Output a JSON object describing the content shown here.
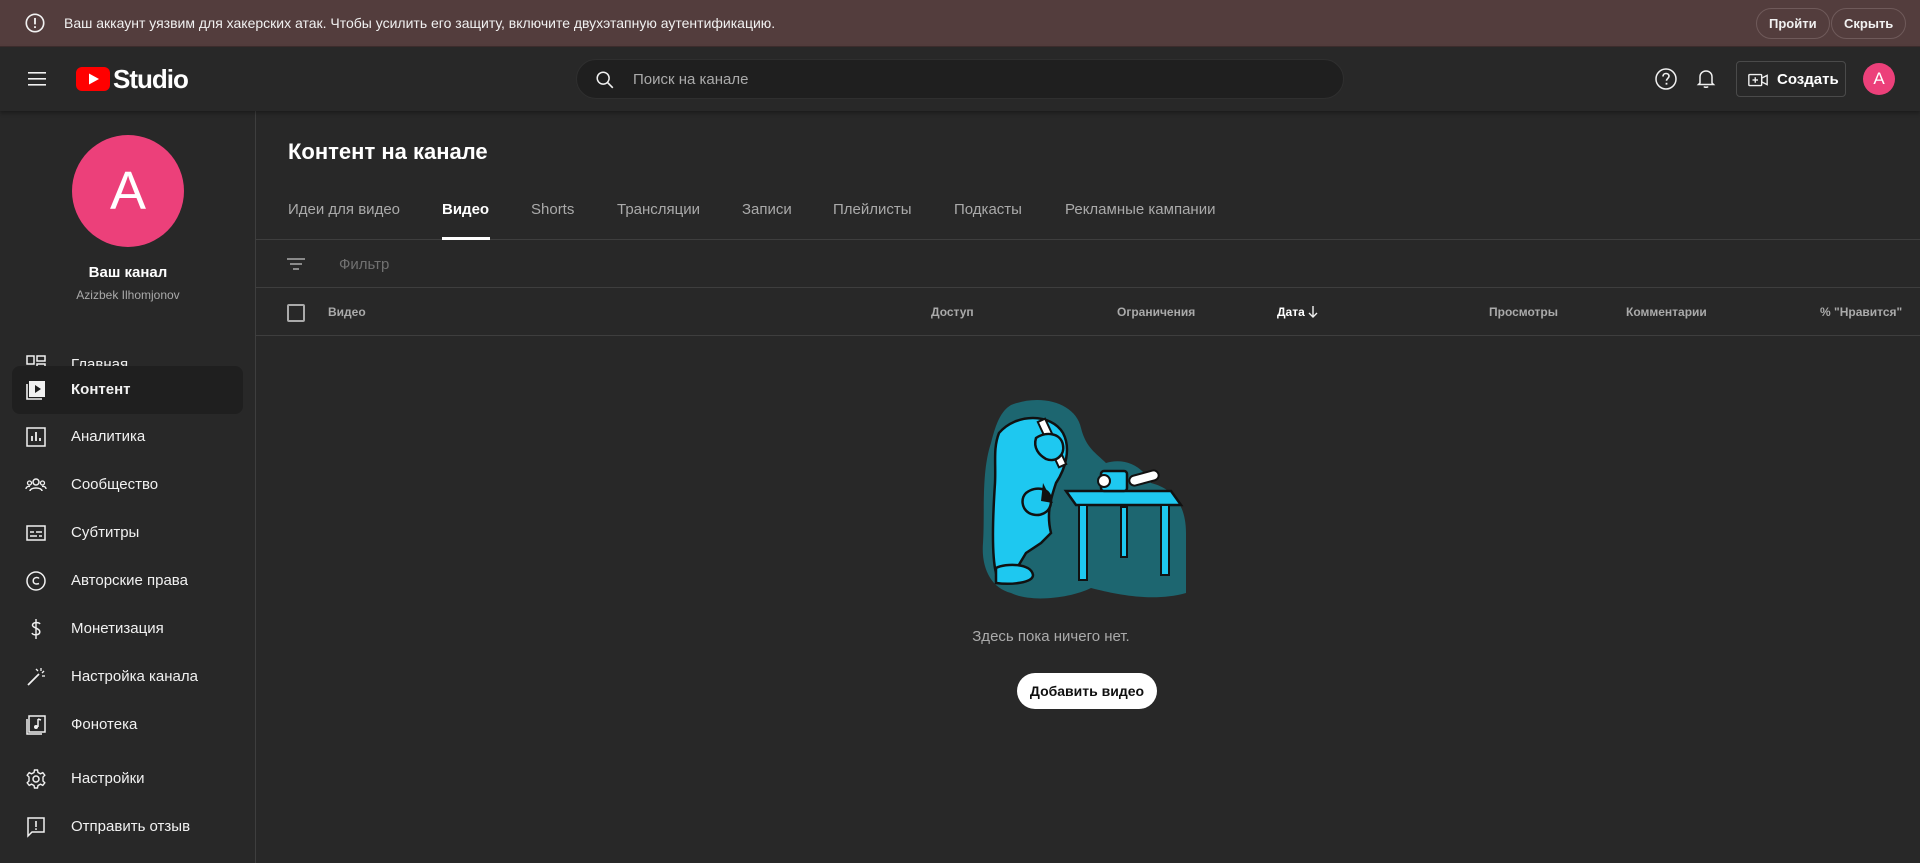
{
  "banner": {
    "text": "Ваш аккаунт уязвим для хакерских атак. Чтобы усилить его защиту, включите двухэтапную аутентификацию.",
    "go_label": "Пройти",
    "hide_label": "Скрыть",
    "icon": "warning-circle-icon",
    "background": "#533d3d"
  },
  "topbar": {
    "logo_text": "Studio",
    "search_placeholder": "Поиск на канале",
    "create_label": "Создать",
    "avatar_letter": "A",
    "avatar_color": "#ec407a"
  },
  "sidebar": {
    "avatar_letter": "A",
    "channel_name": "Ваш канал",
    "channel_handle": "Azizbek Ilhomjonov",
    "items": [
      {
        "label": "Главная",
        "icon": "dashboard-icon"
      },
      {
        "label": "Контент",
        "icon": "content-icon",
        "active": true
      },
      {
        "label": "Аналитика",
        "icon": "analytics-icon"
      },
      {
        "label": "Сообщество",
        "icon": "community-icon"
      },
      {
        "label": "Субтитры",
        "icon": "subtitles-icon"
      },
      {
        "label": "Авторские права",
        "icon": "copyright-icon"
      },
      {
        "label": "Монетизация",
        "icon": "monetization-icon"
      },
      {
        "label": "Настройка канала",
        "icon": "customization-icon"
      },
      {
        "label": "Фонотека",
        "icon": "audio-library-icon"
      },
      {
        "label": "Настройки",
        "icon": "settings-icon"
      },
      {
        "label": "Отправить отзыв",
        "icon": "feedback-icon"
      }
    ]
  },
  "main": {
    "title": "Контент на канале",
    "tabs": [
      {
        "label": "Идеи для видео"
      },
      {
        "label": "Видео",
        "active": true
      },
      {
        "label": "Shorts"
      },
      {
        "label": "Трансляции"
      },
      {
        "label": "Записи"
      },
      {
        "label": "Плейлисты"
      },
      {
        "label": "Подкасты"
      },
      {
        "label": "Рекламные кампании"
      }
    ],
    "filter_placeholder": "Фильтр",
    "columns": [
      "Видео",
      "Доступ",
      "Ограничения",
      "Дата",
      "Просмотры",
      "Комментарии",
      "% \"Нравится\""
    ],
    "sorted_column": "Дата",
    "empty_text": "Здесь пока ничего нет.",
    "add_video_label": "Добавить видео"
  }
}
